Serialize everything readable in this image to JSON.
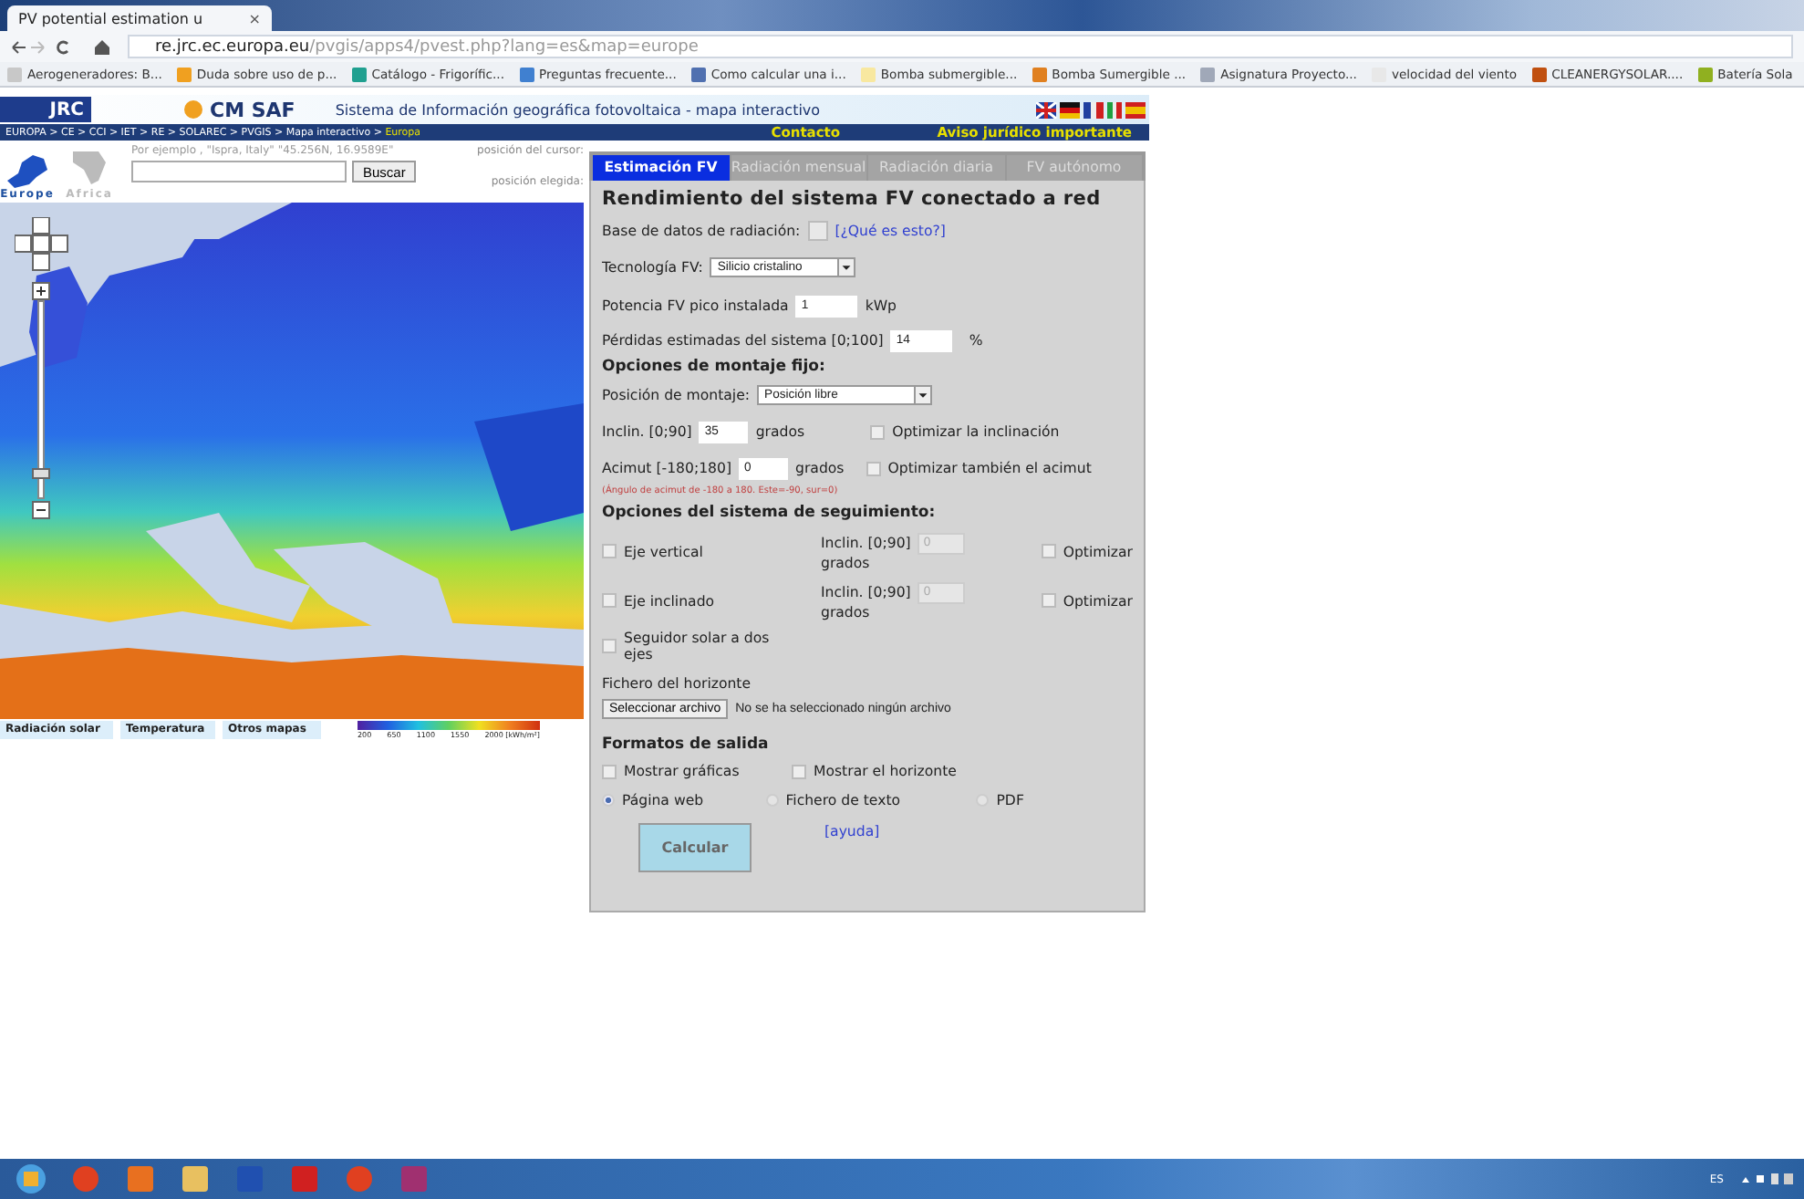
{
  "browser": {
    "tabs": [
      {
        "title": "PV potential estimation u",
        "close": "×",
        "selected": true
      }
    ],
    "url": {
      "host": "re.jrc.ec.europa.eu",
      "path": "/pvgis/apps4/pvest.php?lang=es&map=europe"
    },
    "bookmarks": [
      {
        "label": "Aerogeneradores: B...",
        "color": "#c8c8c8"
      },
      {
        "label": "Duda sobre uso de p...",
        "color": "#f0a020"
      },
      {
        "label": "Catálogo - Frigorífic...",
        "color": "#20a090"
      },
      {
        "label": "Preguntas frecuente...",
        "color": "#4080d0"
      },
      {
        "label": "Como calcular una i...",
        "color": "#5070b0"
      },
      {
        "label": "Bomba submergible...",
        "color": "#f8e8a0"
      },
      {
        "label": "Bomba Sumergible ...",
        "color": "#e08020"
      },
      {
        "label": "Asignatura Proyecto...",
        "color": "#a0a8b8"
      },
      {
        "label": "velocidad del viento",
        "color": "#e8e8e8"
      },
      {
        "label": "CLEANERGYSOLAR....",
        "color": "#c05010"
      },
      {
        "label": "Batería Sola",
        "color": "#90b020"
      }
    ]
  },
  "header": {
    "logo_left": "JRC",
    "logo_right": "CM SAF",
    "title": "Sistema de Información geográfica fotovoltaica - mapa interactivo",
    "breadcrumb": "EUROPA > CE > CCI > IET > RE > SOLAREC > PVGIS > Mapa interactivo > ",
    "breadcrumb_current": "Europa",
    "links": [
      "Contacto",
      "Aviso jurídico importante"
    ]
  },
  "map_panel": {
    "regions": [
      {
        "label": "Europe",
        "selected": true
      },
      {
        "label": "Africa",
        "selected": false
      }
    ],
    "search_hint": "Por ejemplo , \"Ispra, Italy\" \"45.256N, 16.9589E\"",
    "search_button": "Buscar",
    "cursor_label": "posición del cursor:",
    "chosen_label": "posición elegida:",
    "map": {
      "kind": "picture"
    },
    "map_tabs": [
      "Radiación solar",
      "Temperatura",
      "Otros mapas"
    ],
    "legend_ticks": [
      "200",
      "650",
      "1100",
      "1550",
      "2000 [kWh/m²]"
    ]
  },
  "calc": {
    "tabs": [
      {
        "label": "Estimación FV",
        "selected": true
      },
      {
        "label": "Radiación mensual",
        "selected": false
      },
      {
        "label": "Radiación diaria",
        "selected": false
      },
      {
        "label": "FV autónomo",
        "selected": false
      }
    ],
    "title": "Rendimiento del sistema FV conectado a red",
    "radiation_db": {
      "label": "Base de datos de radiación:",
      "link": "[¿Qué es esto?]"
    },
    "technology": {
      "label": "Tecnología FV:",
      "value": "Silicio cristalino"
    },
    "peak_power": {
      "label": "Potencia FV pico instalada",
      "value": "1",
      "unit": "kWp"
    },
    "losses": {
      "label": "Pérdidas estimadas del sistema [0;100]",
      "value": "14",
      "unit": "%"
    },
    "fixed": {
      "heading": "Opciones de montaje fijo:",
      "position": {
        "label": "Posición de montaje:",
        "value": "Posición libre"
      },
      "slope": {
        "label": "Inclin. [0;90]",
        "value": "35",
        "unit": "grados",
        "optimize": {
          "label": "Optimizar la inclinación",
          "checked": false
        }
      },
      "azimuth": {
        "label": "Acimut [-180;180]",
        "value": "0",
        "unit": "grados",
        "optimize": {
          "label": "Optimizar también el acimut",
          "checked": false
        }
      },
      "note": "(Ángulo de acimut de -180 a 180. Este=-90, sur=0)"
    },
    "tracking": {
      "heading": "Opciones del sistema de seguimiento:",
      "options": [
        {
          "label": "Eje vertical",
          "checked": false,
          "slope_label": "Inclin. [0;90]",
          "value": "0",
          "unit": "grados",
          "disabled": true,
          "optimize": {
            "label": "Optimizar",
            "checked": false
          }
        },
        {
          "label": "Eje inclinado",
          "checked": false,
          "slope_label": "Inclin. [0;90]",
          "value": "0",
          "unit": "grados",
          "disabled": true,
          "optimize": {
            "label": "Optimizar",
            "checked": false
          }
        },
        {
          "label": "Seguidor solar a dos ejes",
          "checked": false
        }
      ]
    },
    "horizon": {
      "label": "Fichero del horizonte",
      "button": "Seleccionar archivo",
      "status": "No se ha seleccionado ningún archivo"
    },
    "output": {
      "heading": "Formatos de salida",
      "checks": [
        {
          "label": "Mostrar gráficas",
          "checked": false
        },
        {
          "label": "Mostrar el horizonte",
          "checked": false
        }
      ],
      "formats": [
        {
          "label": "Página web",
          "selected": true
        },
        {
          "label": "Fichero de texto",
          "selected": false
        },
        {
          "label": "PDF",
          "selected": false
        }
      ]
    },
    "calculate": "Calcular",
    "help": "[ayuda]"
  },
  "taskbar": {
    "language": "ES"
  }
}
